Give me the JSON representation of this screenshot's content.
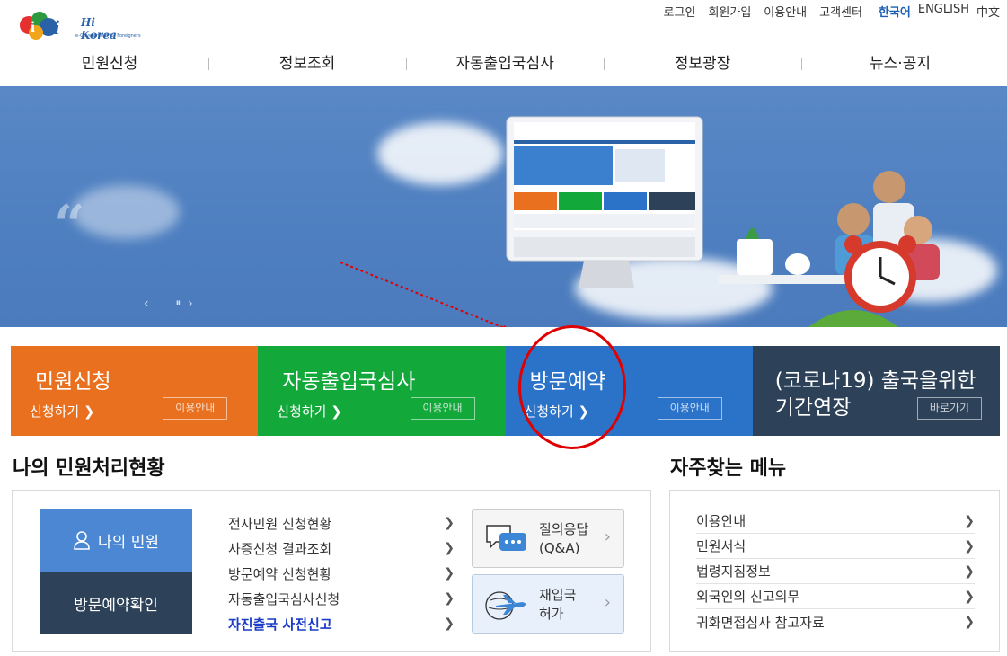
{
  "header": {
    "logo_text": "Hi Korea",
    "logo_sub": "e-Government for Foreigners",
    "util_links": [
      "로그인",
      "회원가입",
      "이용안내",
      "고객센터"
    ],
    "languages": [
      "한국어",
      "ENGLISH",
      "中文"
    ],
    "nav": [
      "민원신청",
      "정보조회",
      "자동출입국심사",
      "정보광장",
      "뉴스·공지"
    ]
  },
  "banner": {
    "quote_mark": "“",
    "prev": "‹",
    "pause": "⏸",
    "next": "›"
  },
  "cards": [
    {
      "title": "민원신청",
      "sub": "신청하기 ❯",
      "btn": "이용안내",
      "color": "#e8701e"
    },
    {
      "title": "자동출입국심사",
      "sub": "신청하기 ❯",
      "btn": "이용안내",
      "color": "#12a83a"
    },
    {
      "title": "방문예약",
      "sub": "신청하기 ❯",
      "btn": "이용안내",
      "color": "#2b73c9"
    },
    {
      "title_line1": "(코로나19) 출국을위한",
      "title_line2": "기간연장",
      "btn": "바로가기",
      "color": "#2d4258"
    }
  ],
  "status": {
    "heading": "나의 민원처리현황",
    "my_button": "나의 민원",
    "visit_button": "방문예약확인",
    "links": [
      "전자민원 신청현황",
      "사증신청 결과조회",
      "방문예약 신청현황",
      "자동출입국심사신청",
      "자진출국 사전신고"
    ],
    "qna_line1": "질의응답",
    "qna_line2": "(Q&A)",
    "reentry_line1": "재입국",
    "reentry_line2": "허가"
  },
  "favorites": {
    "heading": "자주찾는 메뉴",
    "items": [
      "이용안내",
      "민원서식",
      "법령지침정보",
      "외국인의 신고의무",
      "귀화면접심사 참고자료"
    ]
  }
}
